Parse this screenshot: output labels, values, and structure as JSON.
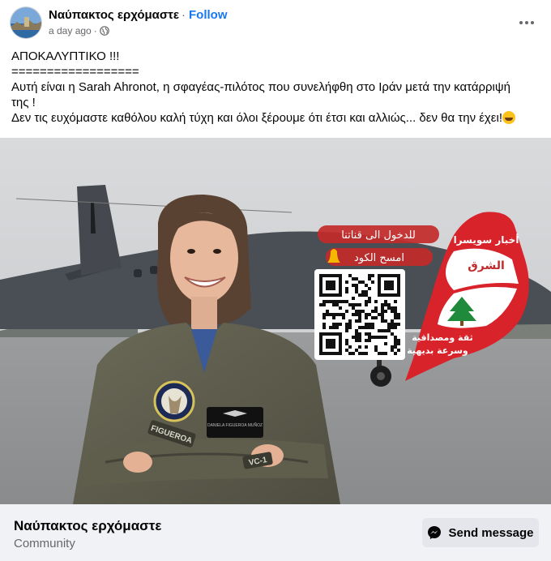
{
  "post": {
    "page_name": "Ναύπακτος ερχόμαστε",
    "separator": "·",
    "follow_label": "Follow",
    "time": "a day ago",
    "meta_separator": "·",
    "privacy_icon": "globe-icon",
    "more_icon": "more-dots-icon"
  },
  "text": {
    "line1": "ΑΠΟΚΑΛΥΠΤΙΚΟ !!!",
    "line2": "==================",
    "line3": "Αυτή είναι η Sarah Ahronot, η σφαγέας-πιλότος που συνελήφθη στο Ιράν μετά την κατάρριψή",
    "line4": "της !",
    "line5": "Δεν τις ευχόμαστε καθόλου καλή τύχη και όλοι ξέρουμε ότι έτσι και αλλιώς... δεν θα την έχει!",
    "emoji": "grinning-squinting-face-emoji"
  },
  "image": {
    "overlay_line1": "للدخول الى قناتنا",
    "overlay_line2": "امسح الكود",
    "brand_line1": "أخبار سويسرا",
    "brand_line2": "الشرق",
    "tagline1": "ثقة ومصداقية",
    "tagline2": "وسرعة بديهية",
    "patch_left": "FIGUEROA",
    "patch_right": "VC-1",
    "name_tag": "DANIELA FIGUEROA MUÑOZ"
  },
  "footer": {
    "name": "Ναύπακτος ερχόμαστε",
    "category": "Community",
    "send_label": "Send message",
    "send_icon": "messenger-icon"
  },
  "colors": {
    "link": "#1877f2",
    "secondary_text": "#65676b",
    "footer_bg": "#f0f2f5",
    "button_bg": "#e4e6eb"
  }
}
